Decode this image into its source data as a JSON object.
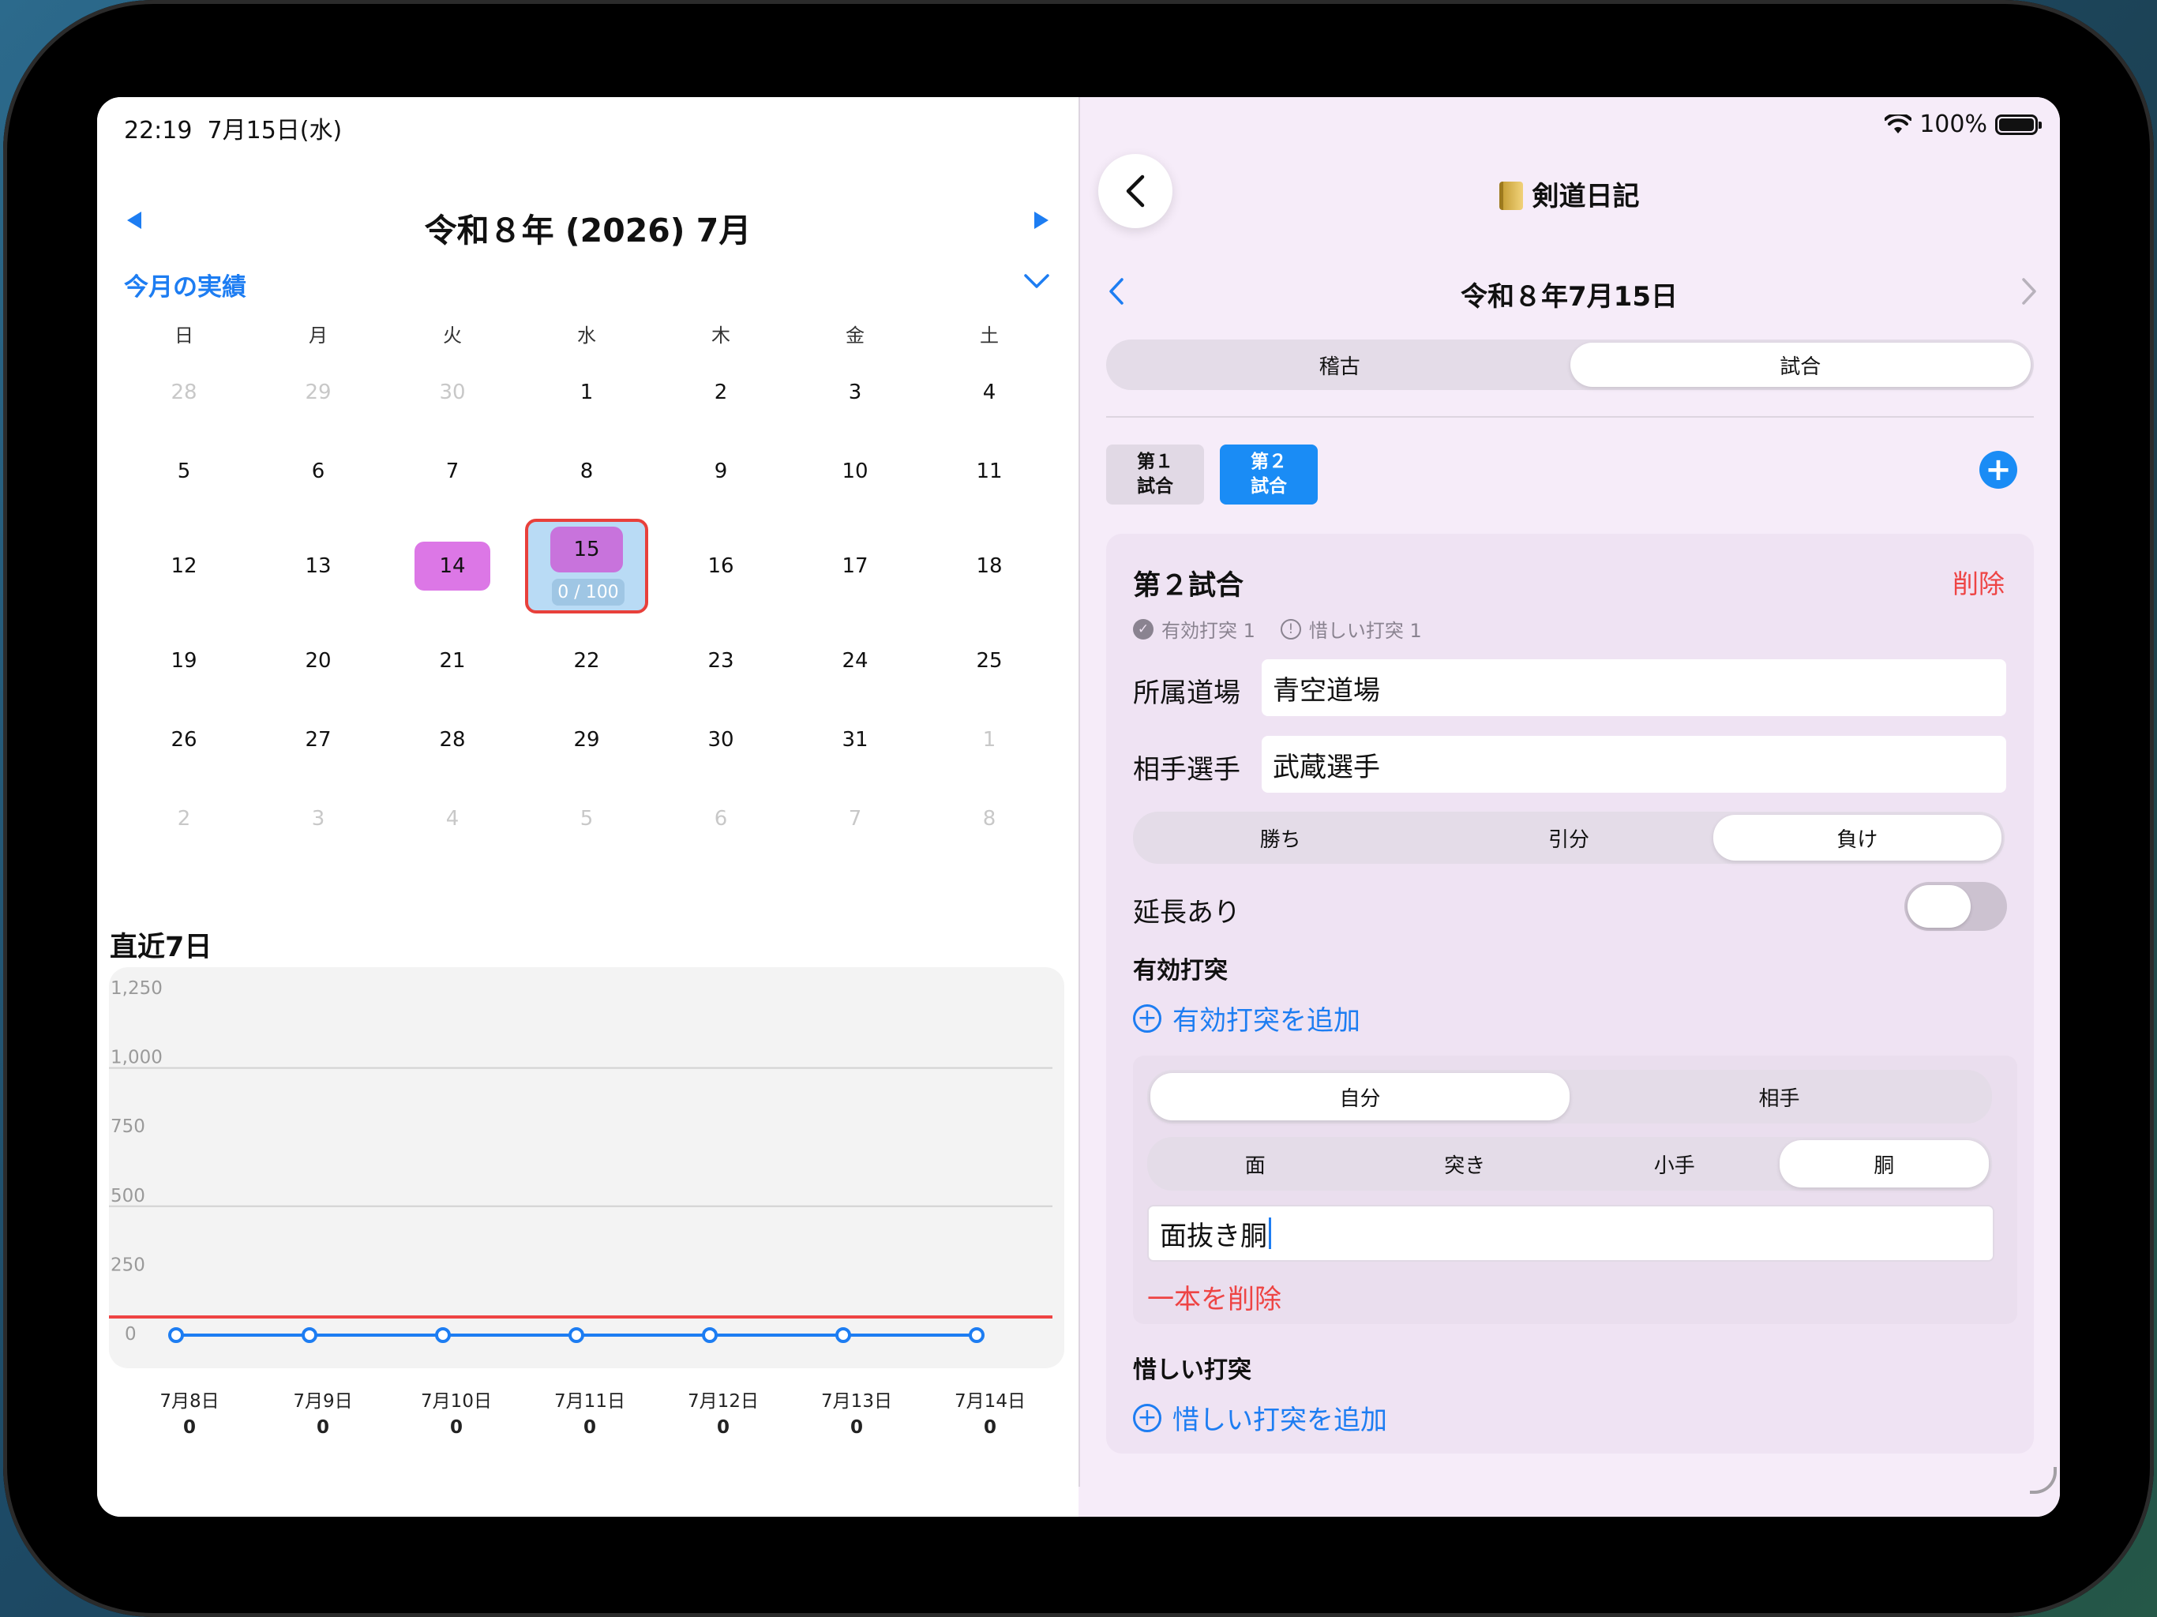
{
  "status": {
    "time": "22:19",
    "date": "7月15日(水)",
    "battery": "100%"
  },
  "calendar": {
    "title": "令和８年 (2026) 7月",
    "summary_link": "今月の実績",
    "weekdays": [
      "日",
      "月",
      "火",
      "水",
      "木",
      "金",
      "土"
    ],
    "weeks": [
      [
        {
          "d": "28",
          "dim": true
        },
        {
          "d": "29",
          "dim": true
        },
        {
          "d": "30",
          "dim": true
        },
        {
          "d": "1"
        },
        {
          "d": "2"
        },
        {
          "d": "3"
        },
        {
          "d": "4"
        }
      ],
      [
        {
          "d": "5"
        },
        {
          "d": "6"
        },
        {
          "d": "7"
        },
        {
          "d": "8"
        },
        {
          "d": "9"
        },
        {
          "d": "10"
        },
        {
          "d": "11"
        }
      ],
      [
        {
          "d": "12"
        },
        {
          "d": "13"
        },
        {
          "d": "14",
          "mark": "practice"
        },
        {
          "d": "15",
          "today": true,
          "goal": "0 / 100"
        },
        {
          "d": "16"
        },
        {
          "d": "17"
        },
        {
          "d": "18"
        }
      ],
      [
        {
          "d": "19"
        },
        {
          "d": "20"
        },
        {
          "d": "21"
        },
        {
          "d": "22"
        },
        {
          "d": "23"
        },
        {
          "d": "24"
        },
        {
          "d": "25"
        }
      ],
      [
        {
          "d": "26"
        },
        {
          "d": "27"
        },
        {
          "d": "28"
        },
        {
          "d": "29"
        },
        {
          "d": "30"
        },
        {
          "d": "31"
        },
        {
          "d": "1",
          "dim": true
        }
      ],
      [
        {
          "d": "2",
          "dim": true
        },
        {
          "d": "3",
          "dim": true
        },
        {
          "d": "4",
          "dim": true
        },
        {
          "d": "5",
          "dim": true
        },
        {
          "d": "6",
          "dim": true
        },
        {
          "d": "7",
          "dim": true
        },
        {
          "d": "8",
          "dim": true
        }
      ]
    ],
    "colors": {
      "accent": "#1d7df2",
      "practice": "#dc77e6",
      "today_border": "#e8403b",
      "today_bg": "#b9dbf5"
    }
  },
  "recent": {
    "title": "直近7日",
    "chart_data": {
      "type": "line",
      "categories": [
        "7月8日",
        "7月9日",
        "7月10日",
        "7月11日",
        "7月12日",
        "7月13日",
        "7月14日"
      ],
      "values": [
        0,
        0,
        0,
        0,
        0,
        0,
        0
      ],
      "value_labels": [
        "0",
        "0",
        "0",
        "0",
        "0",
        "0",
        "0"
      ],
      "yticks": [
        "1,250",
        "1,000",
        "750",
        "500",
        "250",
        "0"
      ],
      "ylim": [
        0,
        1250
      ],
      "goal_line": 100,
      "colors": {
        "line": "#1d7df2",
        "goal": "#ee4444"
      },
      "grid": true
    }
  },
  "detail": {
    "app_title": "剣道日記",
    "date": "令和８年7月15日",
    "mode_tabs": [
      {
        "label": "稽古",
        "active": false
      },
      {
        "label": "試合",
        "active": true
      }
    ],
    "game_tabs": [
      {
        "line1": "第１",
        "line2": "試合",
        "active": false
      },
      {
        "line1": "第２",
        "line2": "試合",
        "active": true
      }
    ],
    "game": {
      "title": "第２試合",
      "delete_label": "削除",
      "stat_valid": "有効打突 1",
      "stat_regret": "惜しい打突 1",
      "dojo_label": "所属道場",
      "dojo_value": "青空道場",
      "opponent_label": "相手選手",
      "opponent_value": "武蔵選手",
      "result_options": [
        {
          "label": "勝ち",
          "active": false
        },
        {
          "label": "引分",
          "active": false
        },
        {
          "label": "負け",
          "active": true
        }
      ],
      "extension_label": "延長あり",
      "extension_on": false,
      "valid_section": "有効打突",
      "add_valid": "有効打突を追加",
      "strike": {
        "side_options": [
          {
            "label": "自分",
            "active": true
          },
          {
            "label": "相手",
            "active": false
          }
        ],
        "target_options": [
          {
            "label": "面",
            "active": false
          },
          {
            "label": "突き",
            "active": false
          },
          {
            "label": "小手",
            "active": false
          },
          {
            "label": "胴",
            "active": true
          }
        ],
        "technique": "面抜き胴",
        "delete_label": "一本を削除"
      },
      "regret_section": "惜しい打突",
      "add_regret": "惜しい打突を追加"
    }
  }
}
